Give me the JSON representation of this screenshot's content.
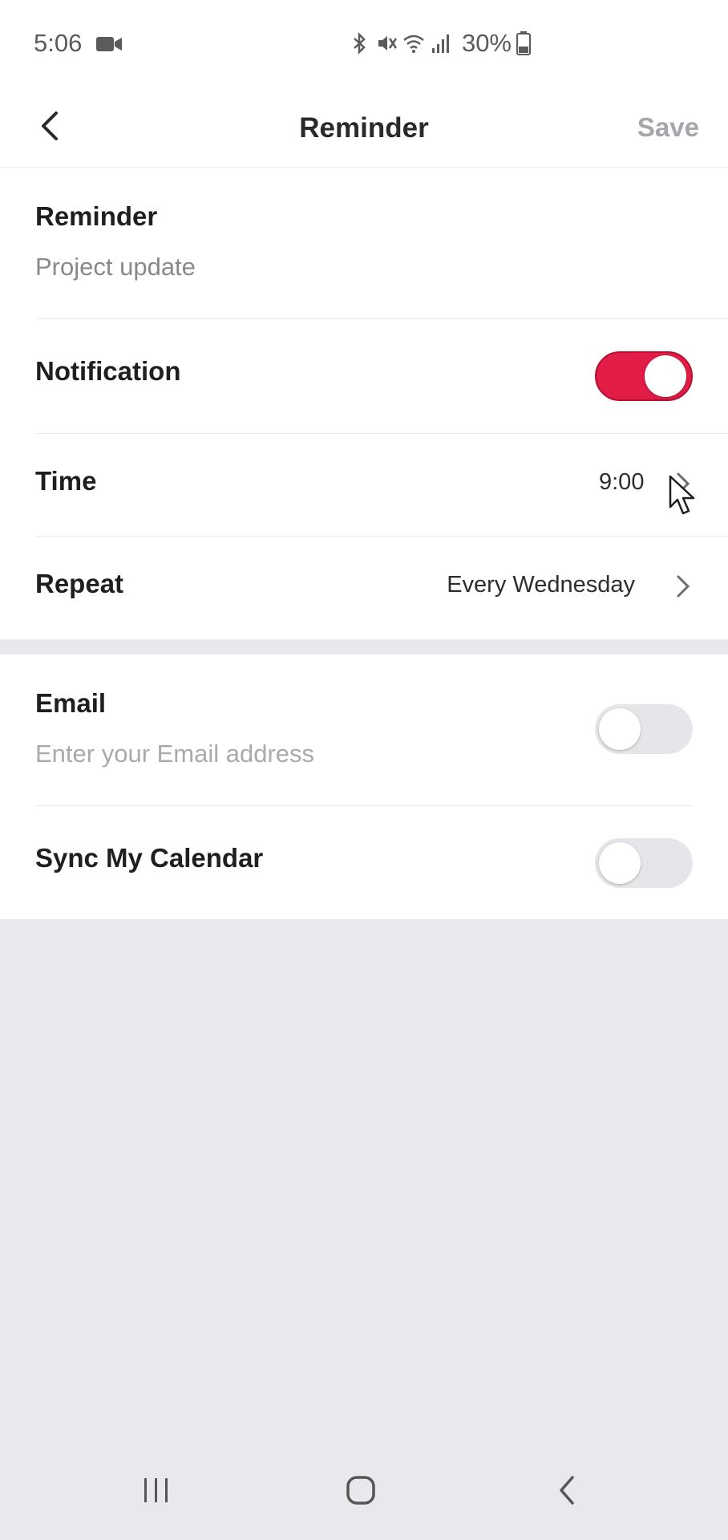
{
  "status_bar": {
    "time": "5:06",
    "battery": "30%",
    "icons": [
      "video-camera-icon",
      "bluetooth-icon",
      "mute-icon",
      "wifi-icon",
      "signal-icon",
      "battery-icon"
    ]
  },
  "header": {
    "title": "Reminder",
    "save_label": "Save",
    "back_icon": "chevron-left-icon"
  },
  "form": {
    "reminder": {
      "label": "Reminder",
      "value": "Project update"
    },
    "notification": {
      "label": "Notification",
      "enabled": true
    },
    "time": {
      "label": "Time",
      "value": "9:00"
    },
    "repeat": {
      "label": "Repeat",
      "value": "Every Wednesday"
    },
    "email": {
      "label": "Email",
      "placeholder": "Enter your Email address",
      "enabled": false
    },
    "sync_calendar": {
      "label": "Sync My Calendar",
      "enabled": false
    }
  },
  "colors": {
    "accent": "#e11d47",
    "toggle_off": "#e5e6ea",
    "muted_text": "#86898d",
    "save_disabled": "#a3a6aa",
    "background": "#e8e9ed"
  },
  "nav_bar": {
    "icons": [
      "recent-apps-icon",
      "home-icon",
      "back-icon"
    ]
  }
}
